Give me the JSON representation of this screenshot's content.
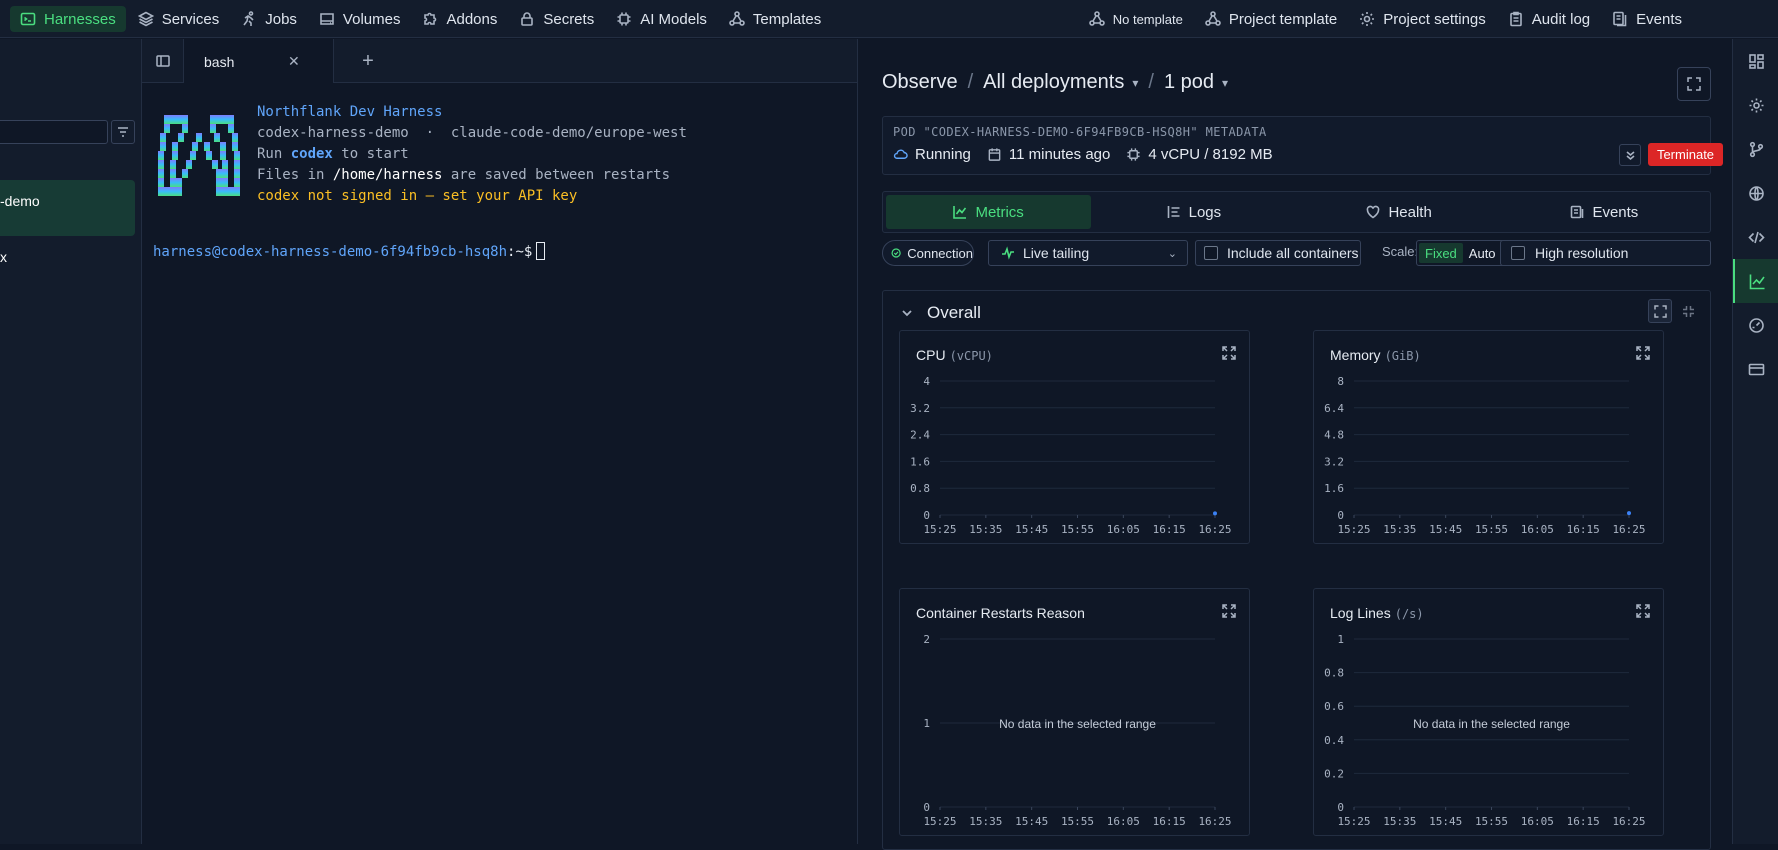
{
  "nav": {
    "left": [
      {
        "label": "Harnesses",
        "icon": "terminal-icon",
        "active": true
      },
      {
        "label": "Services",
        "icon": "layers-icon"
      },
      {
        "label": "Jobs",
        "icon": "run-icon"
      },
      {
        "label": "Volumes",
        "icon": "drive-icon"
      },
      {
        "label": "Addons",
        "icon": "puzzle-icon"
      },
      {
        "label": "Secrets",
        "icon": "lock-icon"
      },
      {
        "label": "AI Models",
        "icon": "chip-icon"
      },
      {
        "label": "Templates",
        "icon": "nodes-icon"
      }
    ],
    "right": [
      {
        "label": "No template",
        "icon": "nodes-icon"
      },
      {
        "label": "Project template",
        "icon": "nodes-icon"
      },
      {
        "label": "Project settings",
        "icon": "gear-icon"
      },
      {
        "label": "Audit log",
        "icon": "clipboard-icon"
      },
      {
        "label": "Events",
        "icon": "list-icon"
      }
    ]
  },
  "sidebar": {
    "selected_item": "-demo",
    "item2": "x"
  },
  "terminal": {
    "tab_label": "bash",
    "banner": {
      "title": "Northflank Dev Harness",
      "service": "codex-harness-demo",
      "dot": "·",
      "project": "claude-code-demo/europe-west",
      "run_pre": "Run ",
      "run_cmd": "codex",
      "run_post": " to start",
      "files_pre": "Files in ",
      "files_path": "/home/harness",
      "files_post": " are saved between restarts",
      "warning": "codex not signed in — set your API key"
    },
    "prompt_user": "harness@codex-harness-demo-6f94fb9cb-hsq8h",
    "prompt_suffix": ":~$"
  },
  "observe": {
    "title": "Observe",
    "deployments": "All deployments",
    "pods": "1 pod",
    "meta_title": "POD \"CODEX-HARNESS-DEMO-6F94FB9CB-HSQ8H\" METADATA",
    "status": "Running",
    "age": "11 minutes ago",
    "resources": "4 vCPU / 8192 MB",
    "terminate": "Terminate",
    "tabs": [
      {
        "label": "Metrics",
        "active": true
      },
      {
        "label": "Logs"
      },
      {
        "label": "Health"
      },
      {
        "label": "Events"
      }
    ],
    "connection": "Connection",
    "live": "Live tailing",
    "include_all": "Include all containers",
    "scale_label": "Scale:",
    "scale_fixed": "Fixed",
    "scale_auto": "Auto",
    "high_res": "High resolution",
    "overall": "Overall",
    "no_data": "No data in the selected range"
  },
  "chart_data": [
    {
      "type": "line",
      "title": "CPU",
      "unit": "(vCPU)",
      "x": [
        "15:25",
        "15:35",
        "15:45",
        "15:55",
        "16:05",
        "16:15",
        "16:25"
      ],
      "yticks": [
        "0",
        "0.8",
        "1.6",
        "2.4",
        "3.2",
        "4"
      ],
      "ylim": [
        0,
        4
      ],
      "series": [
        {
          "points": [
            [
              "16:25",
              0.02
            ]
          ]
        }
      ]
    },
    {
      "type": "line",
      "title": "Memory",
      "unit": "(GiB)",
      "x": [
        "15:25",
        "15:35",
        "15:45",
        "15:55",
        "16:05",
        "16:15",
        "16:25"
      ],
      "yticks": [
        "0",
        "1.6",
        "3.2",
        "4.8",
        "6.4",
        "8"
      ],
      "ylim": [
        0,
        8
      ],
      "series": [
        {
          "points": [
            [
              "16:25",
              0.05
            ]
          ]
        }
      ]
    },
    {
      "type": "line",
      "title": "Container Restarts Reason",
      "unit": "",
      "x": [
        "15:25",
        "15:35",
        "15:45",
        "15:55",
        "16:05",
        "16:15",
        "16:25"
      ],
      "yticks": [
        "0",
        "1",
        "2"
      ],
      "ylim": [
        0,
        2
      ],
      "series": [],
      "no_data": true
    },
    {
      "type": "line",
      "title": "Log Lines",
      "unit": "(/s)",
      "x": [
        "15:25",
        "15:35",
        "15:45",
        "15:55",
        "16:05",
        "16:15",
        "16:25"
      ],
      "yticks": [
        "0",
        "0.2",
        "0.4",
        "0.6",
        "0.8",
        "1"
      ],
      "ylim": [
        0,
        1
      ],
      "series": [],
      "no_data": true
    }
  ],
  "colors": {
    "accent": "#4ade80",
    "danger": "#dc2626",
    "link": "#60a5fa",
    "warning": "#fbbf24"
  }
}
